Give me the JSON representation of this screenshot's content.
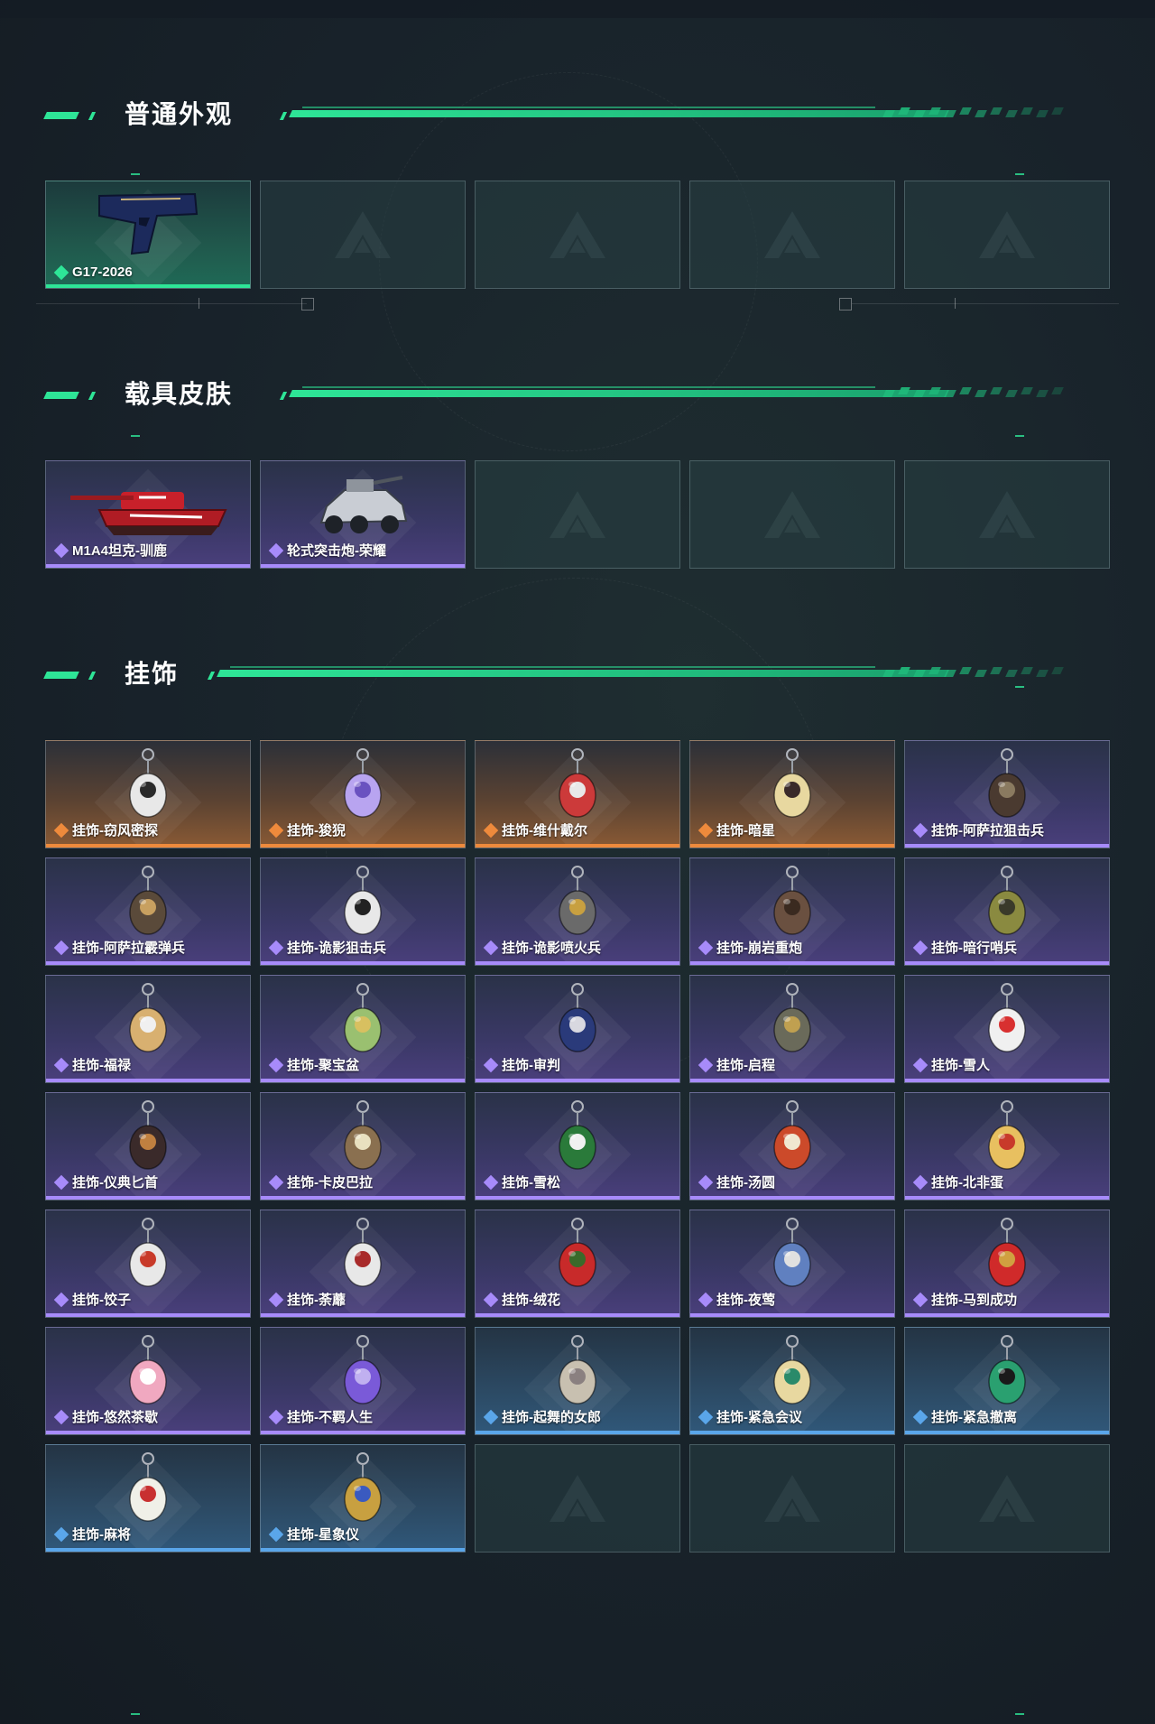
{
  "sections": [
    {
      "title": "普通外观",
      "items": [
        {
          "label": "G17-2026",
          "rarity": "green",
          "icon": "pistol-icon"
        },
        {
          "label": "",
          "rarity": "empty"
        },
        {
          "label": "",
          "rarity": "empty"
        },
        {
          "label": "",
          "rarity": "empty"
        },
        {
          "label": "",
          "rarity": "empty"
        }
      ]
    },
    {
      "title": "载具皮肤",
      "items": [
        {
          "label": "M1A4坦克-驯鹿",
          "rarity": "purple",
          "icon": "tank-icon"
        },
        {
          "label": "轮式突击炮-荣耀",
          "rarity": "purple",
          "icon": "armored-car-icon"
        },
        {
          "label": "",
          "rarity": "empty"
        },
        {
          "label": "",
          "rarity": "empty"
        },
        {
          "label": "",
          "rarity": "empty"
        }
      ]
    },
    {
      "title": "挂饰",
      "items": [
        {
          "label": "挂饰-窃风密探",
          "rarity": "orange",
          "icon": "charm-icon"
        },
        {
          "label": "挂饰-狻猊",
          "rarity": "orange",
          "icon": "charm-icon"
        },
        {
          "label": "挂饰-维什戴尔",
          "rarity": "orange",
          "icon": "charm-icon"
        },
        {
          "label": "挂饰-暗星",
          "rarity": "orange",
          "icon": "charm-icon"
        },
        {
          "label": "挂饰-阿萨拉狙击兵",
          "rarity": "purple",
          "icon": "charm-icon"
        },
        {
          "label": "挂饰-阿萨拉霰弹兵",
          "rarity": "purple",
          "icon": "charm-icon"
        },
        {
          "label": "挂饰-诡影狙击兵",
          "rarity": "purple",
          "icon": "charm-icon"
        },
        {
          "label": "挂饰-诡影喷火兵",
          "rarity": "purple",
          "icon": "charm-icon"
        },
        {
          "label": "挂饰-崩岩重炮",
          "rarity": "purple",
          "icon": "charm-icon"
        },
        {
          "label": "挂饰-暗行哨兵",
          "rarity": "purple",
          "icon": "charm-icon"
        },
        {
          "label": "挂饰-福禄",
          "rarity": "purple",
          "icon": "charm-icon"
        },
        {
          "label": "挂饰-聚宝盆",
          "rarity": "purple",
          "icon": "charm-icon"
        },
        {
          "label": "挂饰-审判",
          "rarity": "purple",
          "icon": "charm-icon"
        },
        {
          "label": "挂饰-启程",
          "rarity": "purple",
          "icon": "charm-icon"
        },
        {
          "label": "挂饰-雪人",
          "rarity": "purple",
          "icon": "charm-icon"
        },
        {
          "label": "挂饰-仪典匕首",
          "rarity": "purple",
          "icon": "charm-icon"
        },
        {
          "label": "挂饰-卡皮巴拉",
          "rarity": "purple",
          "icon": "charm-icon"
        },
        {
          "label": "挂饰-雪松",
          "rarity": "purple",
          "icon": "charm-icon"
        },
        {
          "label": "挂饰-汤圆",
          "rarity": "purple",
          "icon": "charm-icon"
        },
        {
          "label": "挂饰-北非蛋",
          "rarity": "purple",
          "icon": "charm-icon"
        },
        {
          "label": "挂饰-饺子",
          "rarity": "purple",
          "icon": "charm-icon"
        },
        {
          "label": "挂饰-荼蘼",
          "rarity": "purple",
          "icon": "charm-icon"
        },
        {
          "label": "挂饰-绒花",
          "rarity": "purple",
          "icon": "charm-icon"
        },
        {
          "label": "挂饰-夜莺",
          "rarity": "purple",
          "icon": "charm-icon"
        },
        {
          "label": "挂饰-马到成功",
          "rarity": "purple",
          "icon": "charm-icon"
        },
        {
          "label": "挂饰-悠然茶歇",
          "rarity": "purple",
          "icon": "charm-icon"
        },
        {
          "label": "挂饰-不羁人生",
          "rarity": "purple",
          "icon": "charm-icon"
        },
        {
          "label": "挂饰-起舞的女郎",
          "rarity": "blue",
          "icon": "charm-icon"
        },
        {
          "label": "挂饰-紧急会议",
          "rarity": "blue",
          "icon": "charm-icon"
        },
        {
          "label": "挂饰-紧急撤离",
          "rarity": "blue",
          "icon": "charm-icon"
        },
        {
          "label": "挂饰-麻将",
          "rarity": "blue",
          "icon": "charm-icon"
        },
        {
          "label": "挂饰-星象仪",
          "rarity": "blue",
          "icon": "charm-icon"
        },
        {
          "label": "",
          "rarity": "empty"
        },
        {
          "label": "",
          "rarity": "empty"
        },
        {
          "label": "",
          "rarity": "empty"
        }
      ]
    }
  ],
  "colors": {
    "accent": "#2ee597",
    "green": "#2ee597",
    "purple": "#a78bfa",
    "orange": "#ee8a3c",
    "blue": "#5aa6ea"
  }
}
